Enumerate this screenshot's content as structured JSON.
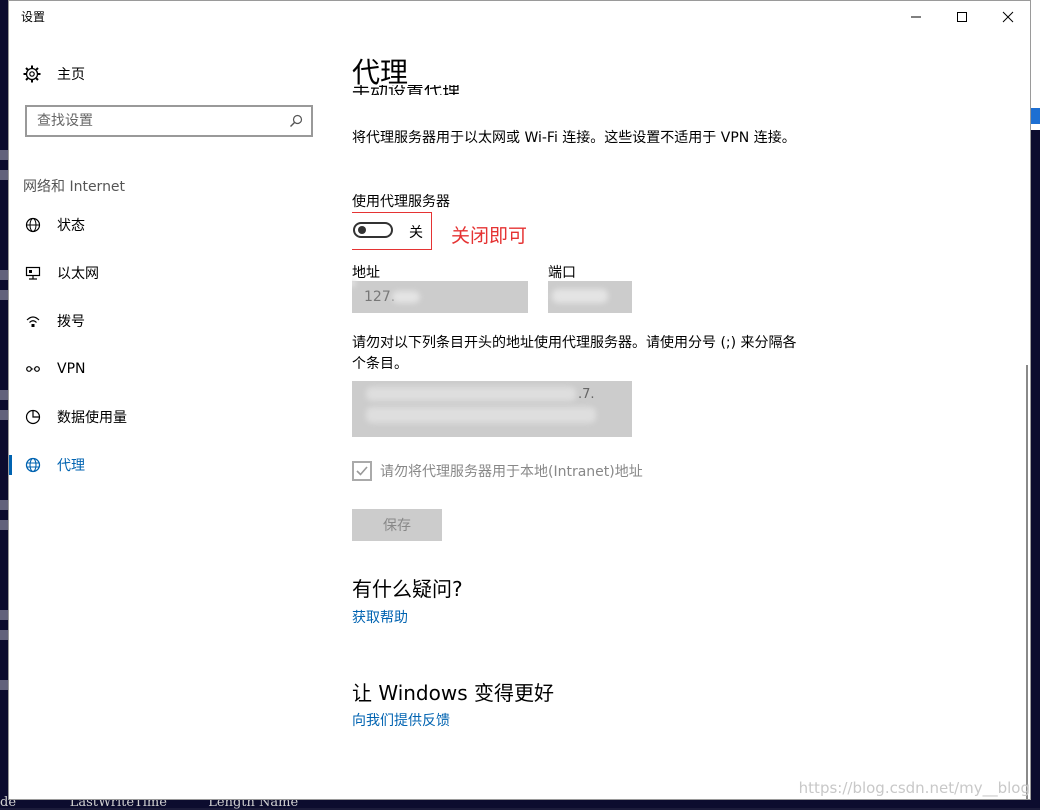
{
  "window": {
    "title": "设置"
  },
  "sidebar": {
    "home_label": "主页",
    "search_placeholder": "查找设置",
    "section_title": "网络和 Internet",
    "items": [
      {
        "label": "状态",
        "icon": "globe-status-icon"
      },
      {
        "label": "以太网",
        "icon": "ethernet-icon"
      },
      {
        "label": "拨号",
        "icon": "dialup-icon"
      },
      {
        "label": "VPN",
        "icon": "vpn-icon"
      },
      {
        "label": "数据使用量",
        "icon": "data-usage-icon"
      },
      {
        "label": "代理",
        "icon": "globe-icon",
        "active": true
      }
    ]
  },
  "main": {
    "title": "代理",
    "cut_heading": "手动设置代理",
    "description": "将代理服务器用于以太网或 Wi-Fi 连接。这些设置不适用于 VPN 连接。",
    "use_proxy_label": "使用代理服务器",
    "toggle_state": "关",
    "annotation": "关闭即可",
    "address_label": "地址",
    "address_value": "127.",
    "port_label": "端口",
    "exceptions_description": "请勿对以下列条目开头的地址使用代理服务器。请使用分号 (;) 来分隔各个条目。",
    "exceptions_visible": ".7.",
    "local_checkbox_label": "请勿将代理服务器用于本地(Intranet)地址",
    "local_checkbox_checked": true,
    "save_label": "保存",
    "questions_heading": "有什么疑问?",
    "help_link": "获取帮助",
    "improve_heading": "让 Windows 变得更好",
    "feedback_link": "向我们提供反馈"
  },
  "background": {
    "console_text": "de             LastWriteTime          Length Name"
  },
  "watermark": "https://blog.csdn.net/my__blog"
}
